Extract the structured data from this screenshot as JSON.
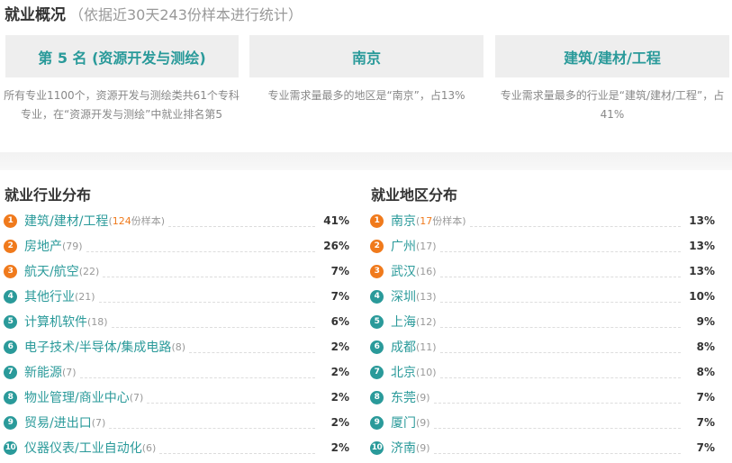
{
  "overview": {
    "title": "就业概况",
    "subtitle": "（依据近30天243份样本进行统计）"
  },
  "cards": [
    {
      "label": "第 5 名 (资源开发与测绘)",
      "desc": "所有专业1100个，资源开发与测绘类共61个专科专业，在“资源开发与测绘”中就业排名第5"
    },
    {
      "label": "南京",
      "desc": "专业需求量最多的地区是“南京”，占13%"
    },
    {
      "label": "建筑/建材/工程",
      "desc": "专业需求量最多的行业是“建筑/建材/工程”，占41%"
    }
  ],
  "industry": {
    "title": "就业行业分布",
    "items": [
      {
        "rank": "1",
        "name": "建筑/建材/工程",
        "count_prefix": "(",
        "count_num": "124",
        "count_suffix": "份样本)",
        "pct": "41%"
      },
      {
        "rank": "2",
        "name": "房地产",
        "count": "(79)",
        "pct": "26%"
      },
      {
        "rank": "3",
        "name": "航天/航空",
        "count": "(22)",
        "pct": "7%"
      },
      {
        "rank": "4",
        "name": "其他行业",
        "count": "(21)",
        "pct": "7%"
      },
      {
        "rank": "5",
        "name": "计算机软件",
        "count": "(18)",
        "pct": "6%"
      },
      {
        "rank": "6",
        "name": "电子技术/半导体/集成电路",
        "count": "(8)",
        "pct": "2%"
      },
      {
        "rank": "7",
        "name": "新能源",
        "count": "(7)",
        "pct": "2%"
      },
      {
        "rank": "8",
        "name": "物业管理/商业中心",
        "count": "(7)",
        "pct": "2%"
      },
      {
        "rank": "9",
        "name": "贸易/进出口",
        "count": "(7)",
        "pct": "2%"
      },
      {
        "rank": "10",
        "name": "仪器仪表/工业自动化",
        "count": "(6)",
        "pct": "2%"
      }
    ]
  },
  "region": {
    "title": "就业地区分布",
    "items": [
      {
        "rank": "1",
        "name": "南京",
        "count_prefix": "(",
        "count_num": "17",
        "count_suffix": "份样本)",
        "pct": "13%"
      },
      {
        "rank": "2",
        "name": "广州",
        "count": "(17)",
        "pct": "13%"
      },
      {
        "rank": "3",
        "name": "武汉",
        "count": "(16)",
        "pct": "13%"
      },
      {
        "rank": "4",
        "name": "深圳",
        "count": "(13)",
        "pct": "10%"
      },
      {
        "rank": "5",
        "name": "上海",
        "count": "(12)",
        "pct": "9%"
      },
      {
        "rank": "6",
        "name": "成都",
        "count": "(11)",
        "pct": "8%"
      },
      {
        "rank": "7",
        "name": "北京",
        "count": "(10)",
        "pct": "8%"
      },
      {
        "rank": "8",
        "name": "东莞",
        "count": "(9)",
        "pct": "7%"
      },
      {
        "rank": "9",
        "name": "厦门",
        "count": "(9)",
        "pct": "7%"
      },
      {
        "rank": "10",
        "name": "济南",
        "count": "(9)",
        "pct": "7%"
      }
    ]
  },
  "colors": {
    "accent": "#2a9a9a",
    "top_rank": "#f07a1c",
    "card_bg": "#eeeeee"
  }
}
